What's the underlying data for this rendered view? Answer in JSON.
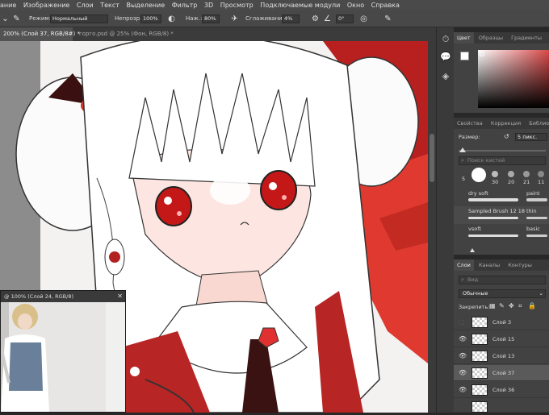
{
  "menubar": {
    "items": [
      "ание",
      "Изображение",
      "Слои",
      "Текст",
      "Выделение",
      "Фильтр",
      "3D",
      "Просмотр",
      "Подключаемые модули",
      "Окно",
      "Справка"
    ]
  },
  "options": {
    "mode_label": "Режим:",
    "mode_value": "Нормальный",
    "opacity_label": "Непрозр.:",
    "opacity_value": "100%",
    "pressure_label": "Наж.:",
    "pressure_value": "80%",
    "smoothing_label": "Сглаживание:",
    "smoothing_value": "4%",
    "angle_value": "0°"
  },
  "doc_tabs": [
    {
      "label": "200% (Слой 37, RGB/8#) *",
      "active": true
    },
    {
      "label": "горго.psd @ 25% (Фон, RGB/8) *",
      "active": false
    }
  ],
  "color_panel": {
    "tabs": [
      "Цвет",
      "Образцы",
      "Градиенты"
    ],
    "accent_top": "#ffffff",
    "accent_bottom": "#000000"
  },
  "brush_panel": {
    "tabs": [
      "Свойства",
      "Коррекция",
      "Библиотеки"
    ],
    "size_label": "Размер:",
    "size_value": "5 пикс.",
    "search_placeholder": "Поиск кистей",
    "preset_sizes": [
      "5",
      "30",
      "20",
      "21",
      "11"
    ],
    "brushes": [
      {
        "left": "dry soft",
        "right": "paint"
      },
      {
        "left": "Sampled Brush 12 18",
        "right": "thin"
      },
      {
        "left": "vsoft",
        "right": "basic"
      }
    ]
  },
  "layers_panel": {
    "tabs": [
      "Слои",
      "Каналы",
      "Контуры"
    ],
    "search_placeholder": "Вид",
    "blend_mode": "Обычные",
    "lock_label": "Закрепить:",
    "layers": [
      {
        "name": "Слой 3",
        "visible": false,
        "selected": false
      },
      {
        "name": "Слой 15",
        "visible": true,
        "selected": false
      },
      {
        "name": "Слой 13",
        "visible": true,
        "selected": false
      },
      {
        "name": "Слой 37",
        "visible": true,
        "selected": true
      },
      {
        "name": "Слой 36",
        "visible": true,
        "selected": false
      }
    ]
  },
  "nav_window": {
    "title": "@ 100% (Слой 24, RGB/8)"
  }
}
